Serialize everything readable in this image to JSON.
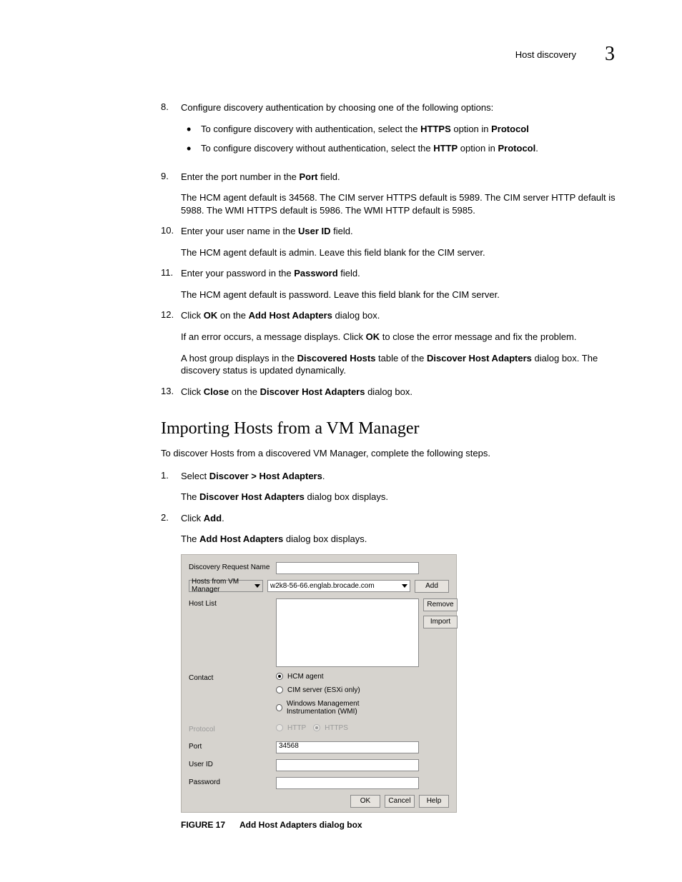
{
  "header": {
    "title": "Host discovery",
    "chapter": "3"
  },
  "steps": [
    {
      "num": "8.",
      "lead": "Configure discovery authentication by choosing one of the following options:",
      "bullets": [
        {
          "pre": "To configure discovery with authentication, select the ",
          "b1": "HTTPS",
          "mid": " option in ",
          "b2": "Protocol"
        },
        {
          "pre": "To configure discovery without authentication, select the ",
          "b1": "HTTP",
          "mid": " option in ",
          "b2": "Protocol",
          "post": "."
        }
      ]
    },
    {
      "num": "9.",
      "lead_pre": "Enter the port number in the ",
      "lead_b": "Port",
      "lead_post": " field.",
      "para": "The HCM agent default is 34568. The CIM server HTTPS default is 5989. The CIM server HTTP default is 5988. The WMI HTTPS default is 5986. The WMI HTTP default is 5985."
    },
    {
      "num": "10.",
      "lead_pre": "Enter your user name in the ",
      "lead_b": "User ID",
      "lead_post": " field.",
      "para": "The HCM agent default is admin. Leave this field blank for the CIM server."
    },
    {
      "num": "11.",
      "lead_pre": "Enter your password in the ",
      "lead_b": "Password",
      "lead_post": " field.",
      "para": "The HCM agent default is password. Leave this field blank for the CIM server."
    },
    {
      "num": "12.",
      "lead_pre": "Click ",
      "lead_b": "OK",
      "lead_mid": " on the ",
      "lead_b2": "Add Host Adapters",
      "lead_post": " dialog box.",
      "para_pre": "If an error occurs, a message displays. Click ",
      "para_b": "OK",
      "para_post": " to close the error message and fix the problem.",
      "para2_pre": "A host group displays in the ",
      "para2_b": "Discovered Hosts",
      "para2_mid": " table of the ",
      "para2_b2": "Discover Host Adapters",
      "para2_post": " dialog box. The discovery status is updated dynamically."
    },
    {
      "num": "13.",
      "lead_pre": "Click ",
      "lead_b": "Close",
      "lead_mid": " on the ",
      "lead_b2": "Discover Host Adapters",
      "lead_post": " dialog box."
    }
  ],
  "section_heading": "Importing Hosts from a VM Manager",
  "section_intro": "To discover Hosts from a discovered VM Manager, complete the following steps.",
  "steps2": [
    {
      "num": "1.",
      "lead_pre": "Select ",
      "lead_b": "Discover > Host Adapters",
      "lead_post": ".",
      "para_pre": "The ",
      "para_b": "Discover Host Adapters",
      "para_post": " dialog box displays."
    },
    {
      "num": "2.",
      "lead_pre": "Click ",
      "lead_b": "Add",
      "lead_post": ".",
      "para_pre": "The ",
      "para_b": "Add Host Adapters",
      "para_post": " dialog box displays."
    }
  ],
  "dialog": {
    "labels": {
      "discoveryRequest": "Discovery Request Name",
      "source": "Hosts from VM Manager",
      "hostList": "Host List",
      "contact": "Contact",
      "protocol": "Protocol",
      "port": "Port",
      "userId": "User ID",
      "password": "Password"
    },
    "values": {
      "vmManager": "w2k8-56-66.englab.brocade.com",
      "port": "34568"
    },
    "contactOptions": {
      "hcm": "HCM agent",
      "cim": "CIM server (ESXi only)",
      "wmi": "Windows Management Instrumentation (WMI)"
    },
    "protocolOptions": {
      "http": "HTTP",
      "https": "HTTPS"
    },
    "buttons": {
      "add": "Add",
      "remove": "Remove",
      "import": "Import",
      "ok": "OK",
      "cancel": "Cancel",
      "help": "Help"
    }
  },
  "figure": {
    "label": "FIGURE 17",
    "title": "Add Host Adapters dialog box"
  }
}
